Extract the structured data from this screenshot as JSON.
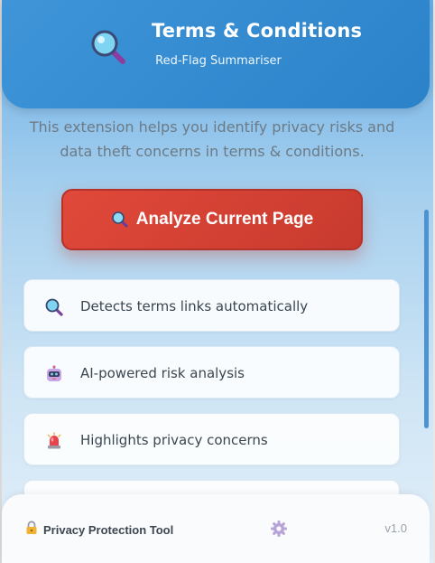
{
  "header": {
    "title": "Terms & Conditions",
    "subtitle": "Red-Flag Summariser",
    "icon": "magnifying-glass-icon"
  },
  "description": "This extension helps you identify privacy risks and data theft concerns in terms & conditions.",
  "analyze_button": {
    "label": "Analyze Current Page",
    "icon": "magnifying-glass-icon",
    "color": "#d8423a"
  },
  "features": [
    {
      "icon": "magnifying-glass-icon",
      "label": "Detects terms links automatically"
    },
    {
      "icon": "robot-icon",
      "label": "AI-powered risk analysis"
    },
    {
      "icon": "siren-icon",
      "label": "Highlights privacy concerns"
    },
    {
      "icon": "",
      "label": ""
    }
  ],
  "footer": {
    "label": "Privacy Protection Tool",
    "lock_icon": "lock-icon",
    "settings_icon": "gear-icon",
    "version": "v1.0"
  },
  "colors": {
    "header": "#3a8fd4",
    "accent": "#d8423a"
  }
}
